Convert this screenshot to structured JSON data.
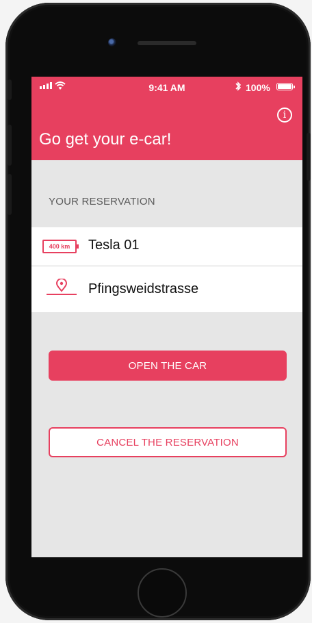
{
  "status_bar": {
    "time": "9:41 AM",
    "battery_percent": "100%"
  },
  "header": {
    "title": "Go get your e-car!",
    "info_icon": "i"
  },
  "reservation": {
    "section_label": "YOUR RESERVATION",
    "car": {
      "range_badge": "400 km",
      "name": "Tesla 01"
    },
    "location": {
      "name": "Pfingsweidstrasse"
    }
  },
  "actions": {
    "open_label": "OPEN THE CAR",
    "cancel_label": "CANCEL THE RESERVATION"
  },
  "colors": {
    "accent": "#e7405f",
    "background": "#e6e6e6"
  },
  "icons": [
    "signal-icon",
    "wifi-icon",
    "bluetooth-icon",
    "battery-icon",
    "info-icon",
    "battery-range-icon",
    "location-pin-icon"
  ]
}
